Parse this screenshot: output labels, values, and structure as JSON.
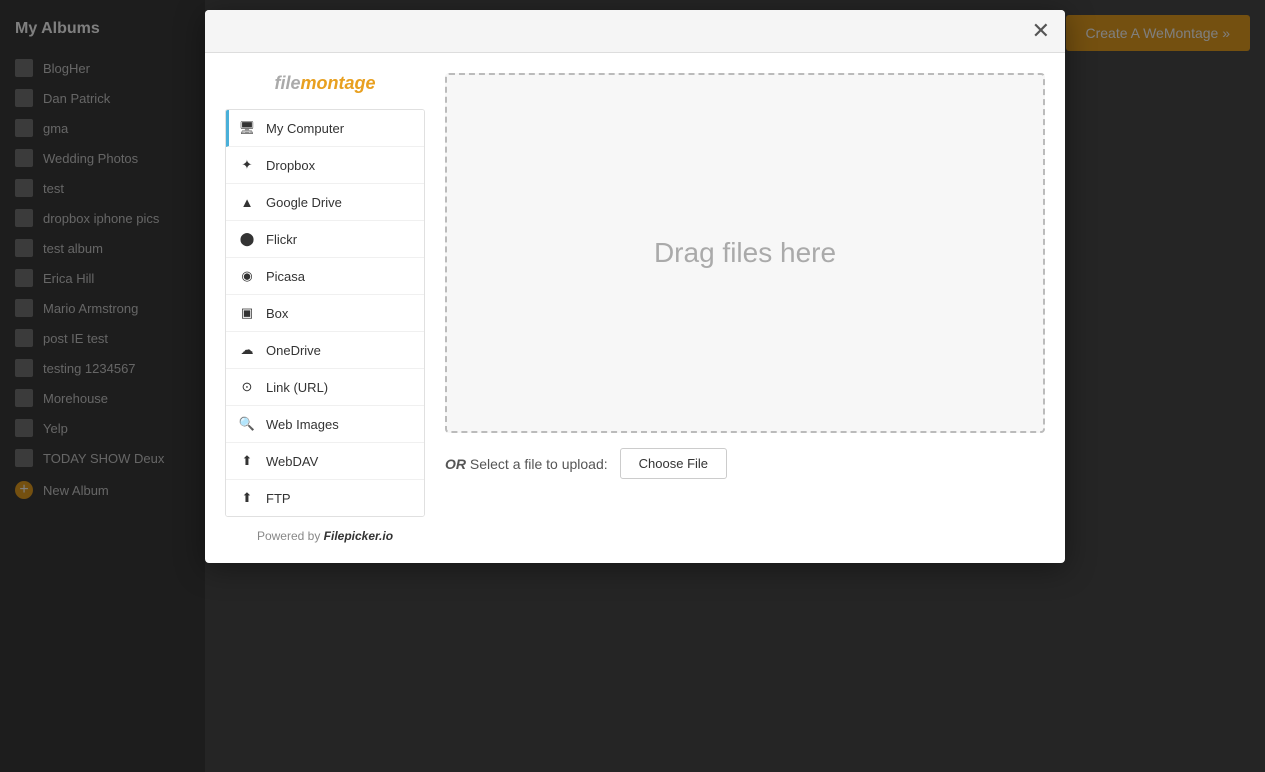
{
  "sidebar": {
    "title": "My Albums",
    "items": [
      {
        "label": "BlogHer"
      },
      {
        "label": "Dan Patrick"
      },
      {
        "label": "gma"
      },
      {
        "label": "Wedding Photos"
      },
      {
        "label": "test"
      },
      {
        "label": "dropbox iphone pics"
      },
      {
        "label": "test album"
      },
      {
        "label": "Erica Hill"
      },
      {
        "label": "Mario Armstrong"
      },
      {
        "label": "post IE test"
      },
      {
        "label": "testing 1234567"
      },
      {
        "label": "Morehouse"
      },
      {
        "label": "Yelp"
      },
      {
        "label": "TODAY SHOW Deux"
      }
    ],
    "new_album": "New Album"
  },
  "create_button": "Create A WeMontage »",
  "modal": {
    "logo_text_normal": "filemontage",
    "logo_text_highlight": "montage",
    "sources": [
      {
        "id": "my-computer",
        "label": "My Computer",
        "icon": "computer",
        "active": true
      },
      {
        "id": "dropbox",
        "label": "Dropbox",
        "icon": "dropbox",
        "active": false
      },
      {
        "id": "google-drive",
        "label": "Google Drive",
        "icon": "gdrive",
        "active": false
      },
      {
        "id": "flickr",
        "label": "Flickr",
        "icon": "flickr",
        "active": false
      },
      {
        "id": "picasa",
        "label": "Picasa",
        "icon": "picasa",
        "active": false
      },
      {
        "id": "box",
        "label": "Box",
        "icon": "box",
        "active": false
      },
      {
        "id": "onedrive",
        "label": "OneDrive",
        "icon": "onedrive",
        "active": false
      },
      {
        "id": "link-url",
        "label": "Link (URL)",
        "icon": "link",
        "active": false
      },
      {
        "id": "web-images",
        "label": "Web Images",
        "icon": "webimages",
        "active": false
      },
      {
        "id": "webdav",
        "label": "WebDAV",
        "icon": "webdav",
        "active": false
      },
      {
        "id": "ftp",
        "label": "FTP",
        "icon": "ftp",
        "active": false
      }
    ],
    "powered_by_prefix": "Powered by ",
    "powered_by_brand": "Filepicker.io",
    "drop_zone_text": "Drag files here",
    "upload_label_or": "OR",
    "upload_label_text": "Select a file to upload:",
    "choose_file_label": "Choose File"
  },
  "colors": {
    "accent": "#e8a020",
    "active_border": "#4ab0d9"
  }
}
